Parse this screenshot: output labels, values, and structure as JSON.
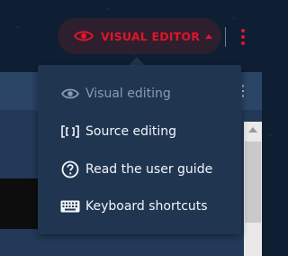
{
  "toolbar": {
    "editor_mode_label": "VISUAL EDITOR",
    "accent_color": "#e0152a"
  },
  "menu": {
    "items": [
      {
        "label": "Visual editing",
        "icon": "eye-icon",
        "disabled": true
      },
      {
        "label": "Source editing",
        "icon": "source-code-icon",
        "disabled": false
      },
      {
        "label": "Read the user guide",
        "icon": "help-circle-icon",
        "disabled": false
      },
      {
        "label": "Keyboard shortcuts",
        "icon": "keyboard-icon",
        "disabled": false
      }
    ]
  }
}
